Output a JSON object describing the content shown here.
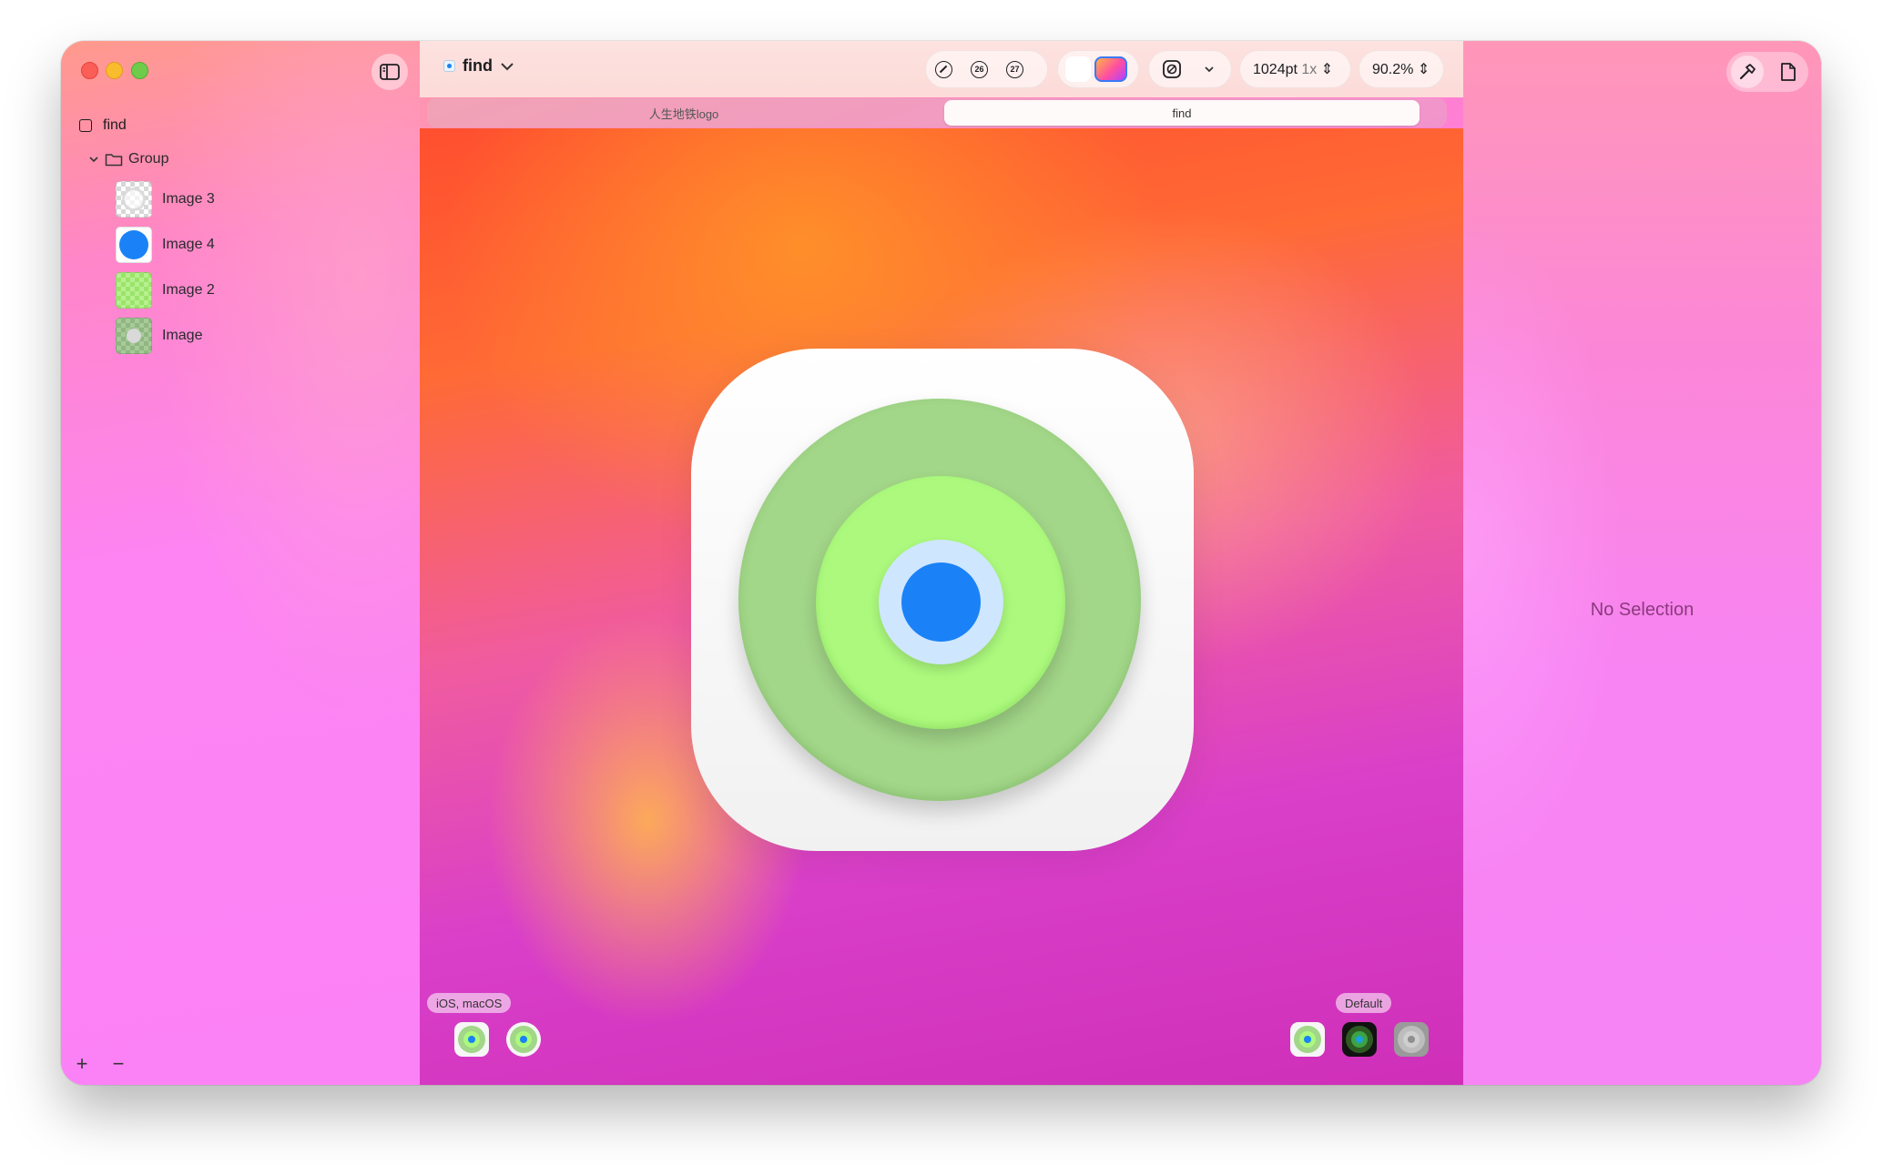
{
  "sidebar": {
    "root_layer": "find",
    "group": "Group",
    "items": [
      {
        "label": "Image 3"
      },
      {
        "label": "Image 4"
      },
      {
        "label": "Image 2"
      },
      {
        "label": "Image"
      }
    ],
    "add_symbol": "+",
    "remove_symbol": "−"
  },
  "toolbar": {
    "document_name": "find",
    "badge_26": "26",
    "badge_27": "27",
    "canvas_size": "1024pt",
    "scale": "1x",
    "zoom": "90.2%"
  },
  "tabs": [
    {
      "label": "人生地铁logo",
      "active": false
    },
    {
      "label": "find",
      "active": true
    }
  ],
  "canvas": {
    "platform_label": "iOS, macOS",
    "appearance_label": "Default",
    "icon_colors": {
      "outer_ring": "#a2d688",
      "middle_ring": "#acf97d",
      "inner_ring": "#cfe6ff",
      "center": "#1a82f6"
    }
  },
  "inspector": {
    "empty_state": "No Selection"
  },
  "icons": [
    "sidebar-toggle-icon",
    "slash-circle-icon",
    "chevron-down-icon",
    "appearance-icon",
    "hammer-icon",
    "document-icon",
    "plus-icon",
    "folder-icon"
  ]
}
